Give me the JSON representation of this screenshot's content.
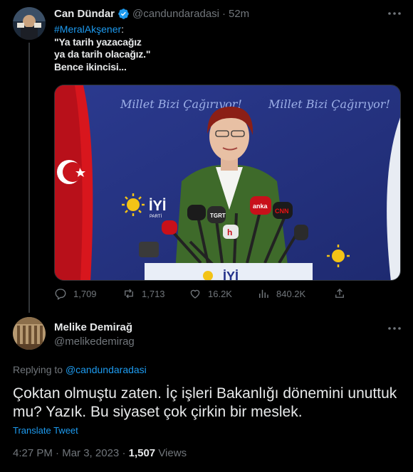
{
  "original_tweet": {
    "author_name": "Can Dündar",
    "author_handle": "@candundaradasi",
    "separator": "·",
    "time_ago": "52m",
    "hashtag": "#MeralAkşener",
    "colon": ":",
    "text_line_1": "\"Ya tarih yazacağız",
    "text_line_2": "ya da tarih olacağız.\"",
    "text_line_3": "Bence ikincisi...",
    "media_text": {
      "banner_top_left": "Millet Bizi Çağırıyor!",
      "banner_top_right": "Millet Bizi Çağırıyor!",
      "party_logo_text": "İYİ",
      "party_subtext": "PARTİ",
      "mic_label_1": "TGRT",
      "mic_label_2": "anka",
      "mic_label_3": "CNN",
      "mic_label_4": "h",
      "podium_text": "İYİ"
    },
    "replies": "1,709",
    "retweets": "1,713",
    "likes": "16.2K",
    "views": "840.2K"
  },
  "reply_tweet": {
    "author_name": "Melike Demirağ",
    "author_handle": "@melikedemirag",
    "replying_to_label": "Replying to",
    "replying_to_handle": "@candundaradasi",
    "text": "Çoktan olmuştu zaten. İç işleri Bakanlığı dönemini unuttuk mu? Yazık. Bu siyaset çok çirkin bir meslek.",
    "translate_label": "Translate Tweet",
    "time": "4:27 PM",
    "dot": "·",
    "date": "Mar 3, 2023",
    "views_count": "1,507",
    "views_label": "Views"
  },
  "colors": {
    "background": "#000000",
    "text_primary": "#e7e9ea",
    "text_secondary": "#71767b",
    "link_blue": "#1d9bf0",
    "divider": "#2f3336"
  }
}
